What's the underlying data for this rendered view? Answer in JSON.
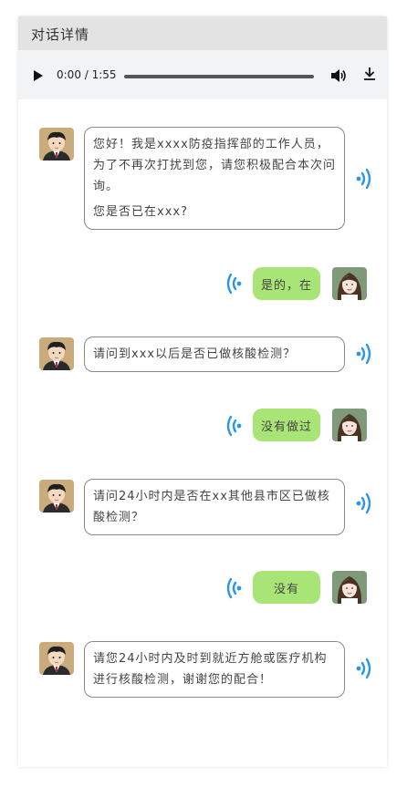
{
  "header": {
    "title": "对话详情"
  },
  "player": {
    "time": "0:00 / 1:55",
    "progress": 0
  },
  "messages": [
    {
      "side": "left",
      "paragraphs": [
        "您好！我是xxxx防疫指挥部的工作人员，为了不再次打扰到您，请您积极配合本次问询。",
        "您是否已在xxx?"
      ]
    },
    {
      "side": "right",
      "text": "是的，在"
    },
    {
      "side": "left",
      "paragraphs": [
        "请问到xxx以后是否已做核酸检测？"
      ]
    },
    {
      "side": "right",
      "text": "没有做过"
    },
    {
      "side": "left",
      "paragraphs": [
        "请问24小时内是否在xx其他县市区已做核酸检测？"
      ]
    },
    {
      "side": "right",
      "text": "没有"
    },
    {
      "side": "left",
      "paragraphs": [
        "请您24小时内及时到就近方舱或医疗机构进行核酸检测，谢谢您的配合！"
      ]
    }
  ],
  "colors": {
    "reply_bubble": "#a8e576",
    "wave_icon": "#2b95e9",
    "header_bg": "#e3e3e3"
  },
  "icons": [
    "play-icon",
    "volume-icon",
    "download-icon",
    "sound-wave-icon",
    "officer-avatar",
    "woman-avatar"
  ]
}
